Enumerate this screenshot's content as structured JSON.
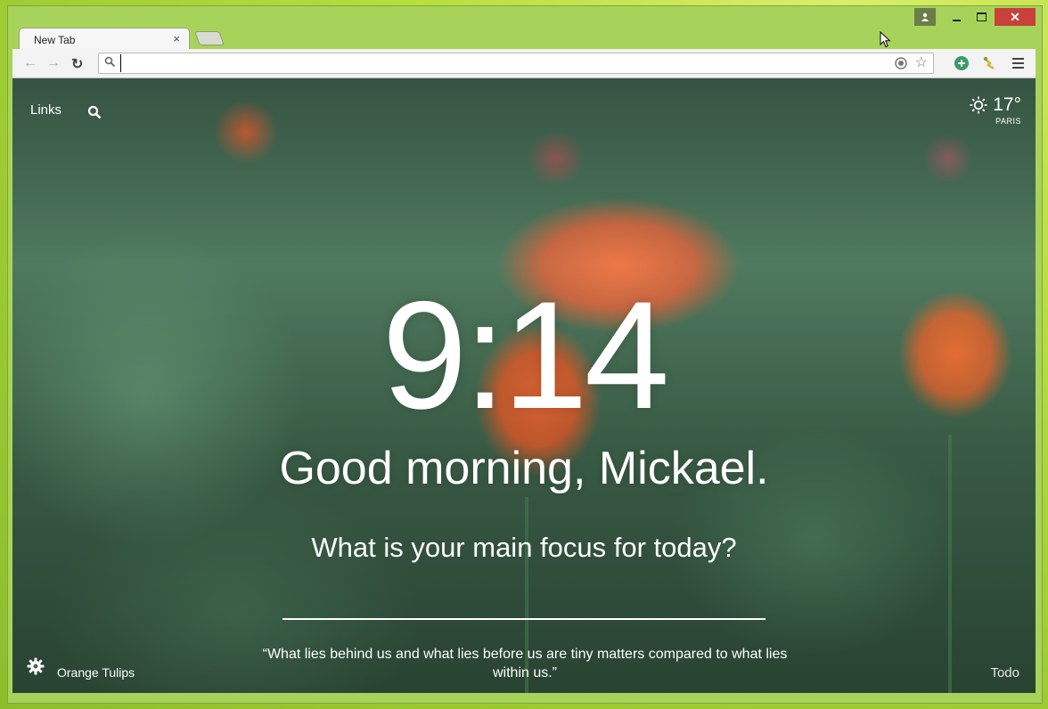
{
  "browser": {
    "tab": {
      "title": "New Tab",
      "close": "×"
    },
    "toolbar": {
      "back": "←",
      "forward": "→",
      "reload": "↻",
      "address_value": "",
      "star": "☆"
    },
    "window_controls": {
      "close": "✕"
    }
  },
  "page": {
    "links_label": "Links",
    "weather": {
      "temperature": "17°",
      "city": "PARIS",
      "icon": "sun-icon"
    },
    "clock": "9:14",
    "greeting": "Good morning, Mickael.",
    "focus_question": "What is your main focus for today?",
    "focus_value": "",
    "photo_name": "Orange Tulips",
    "quote": "“What lies behind us and what lies before us are tiny matters compared to what lies within us.”",
    "todo_label": "Todo"
  },
  "colors": {
    "desktop": "#a8d35a",
    "close_button": "#c8413b",
    "toolbar": "#f3f3f3",
    "page_text": "#ffffff"
  }
}
